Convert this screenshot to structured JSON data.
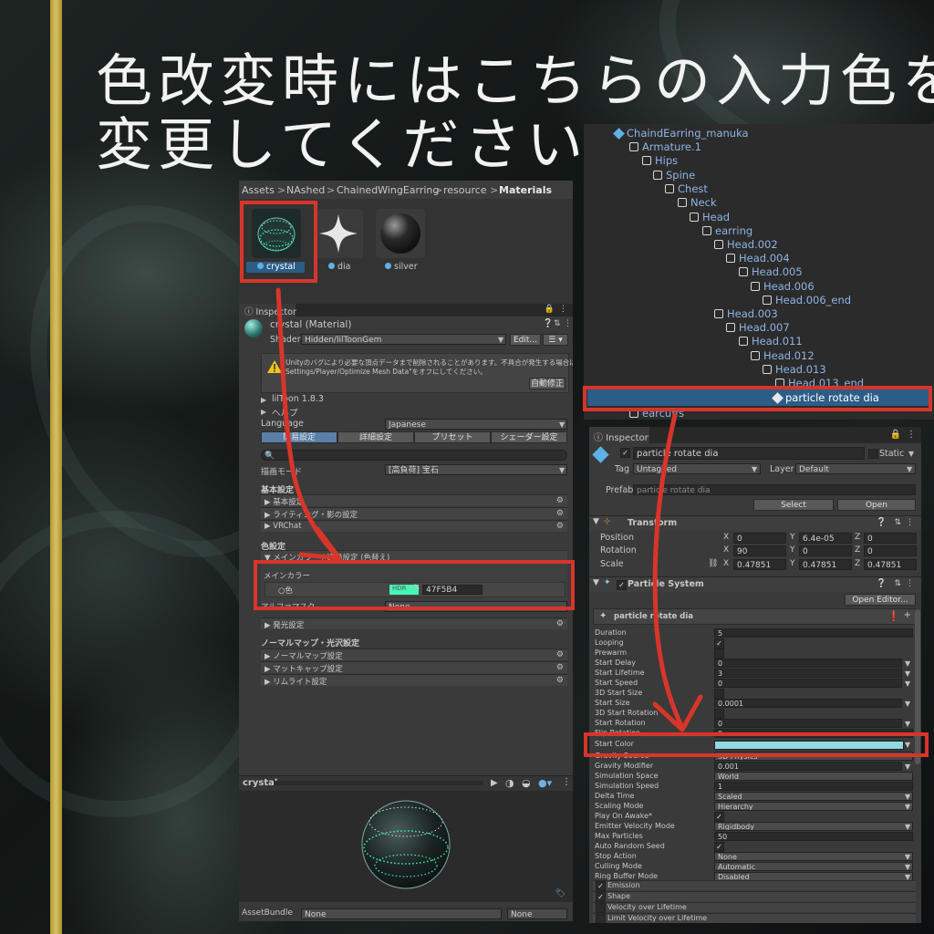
{
  "headline": {
    "line1": "色改変時にはこちらの入力色を",
    "line2": "変更してください。"
  },
  "project": {
    "breadcrumb": [
      "Assets",
      "NAshed",
      "ChainedWingEarring",
      "resource",
      "Materials"
    ],
    "assets": [
      {
        "name": "crystal"
      },
      {
        "name": "dia"
      },
      {
        "name": "silver"
      }
    ]
  },
  "inspector_left": {
    "tab": "Inspector",
    "material_title": "crystal (Material)",
    "shader_label": "Shader",
    "shader_value": "Hidden/lilToonGem",
    "edit_button": "Edit...",
    "warning_line1": "Unityのバグにより必要な頂点データまで削除されることがあります。不具合が発生する場合は\"Project",
    "warning_line2": "Settings/Player/Optimize Mesh Data\"をオフにしてください。",
    "autofix_button": "自動修正",
    "liltoon_version": "lilToon 1.8.3",
    "help": "ヘルプ",
    "language_label": "Language",
    "language_value": "Japanese",
    "tabs": [
      "簡易設定",
      "詳細設定",
      "プリセット",
      "シェーダー設定"
    ],
    "render_mode_label": "描画モード",
    "render_mode_value": "[高負荷] 宝石",
    "basic_heading": "基本設定",
    "basic_sections": [
      "基本設定",
      "ライティング・影の設定",
      "VRChat"
    ],
    "color_heading": "色設定",
    "maincolor_section": "メインカラー / 透過設定 (色替え)",
    "maincolor_label": "メインカラー",
    "color_label": "色",
    "hdr_tag": "HDR",
    "hex_value": "47F5B4",
    "alphamask_label": "アルファマスク",
    "alphamask_value": "None",
    "emission_section": "発光設定",
    "normal_heading": "ノーマルマップ・光沢設定",
    "normal_sections": [
      "ノーマルマップ設定",
      "マットキャップ設定",
      "リムライト設定"
    ],
    "preview_title": "crystal",
    "assetbundle_label": "AssetBundle",
    "assetbundle_value1": "None",
    "assetbundle_value2": "None"
  },
  "hierarchy": {
    "root": "ChaindEarring_manuka",
    "items": [
      {
        "label": "Armature.1"
      },
      {
        "label": "Hips"
      },
      {
        "label": "Spine"
      },
      {
        "label": "Chest"
      },
      {
        "label": "Neck"
      },
      {
        "label": "Head"
      },
      {
        "label": "earring"
      },
      {
        "label": "Head.002"
      },
      {
        "label": "Head.004"
      },
      {
        "label": "Head.005"
      },
      {
        "label": "Head.006"
      },
      {
        "label": "Head.006_end"
      },
      {
        "label": "Head.003"
      },
      {
        "label": "Head.007"
      },
      {
        "label": "Head.011"
      },
      {
        "label": "Head.012"
      },
      {
        "label": "Head.013"
      },
      {
        "label": "Head.013_end"
      }
    ],
    "selected": "particle rotate dia",
    "after": "earcuffs"
  },
  "inspector_right": {
    "tab": "Inspector",
    "object_name": "particle rotate dia",
    "static_label": "Static",
    "tag_label": "Tag",
    "tag_value": "Untagged",
    "layer_label": "Layer",
    "layer_value": "Default",
    "prefab_label": "Prefab",
    "prefab_value": "particle rotate dia",
    "select_button": "Select",
    "open_button": "Open",
    "transform_title": "Transform",
    "transform_rows": [
      {
        "label": "Position",
        "x": "0",
        "y": "6.4e-05",
        "z": "0"
      },
      {
        "label": "Rotation",
        "x": "90",
        "y": "0",
        "z": "0"
      },
      {
        "label": "Scale",
        "x": "0.47851",
        "y": "0.47851",
        "z": "0.47851"
      }
    ],
    "ps_title": "Particle System",
    "open_editor": "Open Editor...",
    "ps_subtitle": "particle rotate dia",
    "props": [
      {
        "label": "Duration",
        "value": "5"
      },
      {
        "label": "Looping",
        "value": "✓"
      },
      {
        "label": "Prewarm",
        "value": ""
      },
      {
        "label": "Start Delay",
        "value": "0"
      },
      {
        "label": "Start Lifetime",
        "value": "3"
      },
      {
        "label": "Start Speed",
        "value": "0"
      },
      {
        "label": "3D Start Size",
        "value": ""
      },
      {
        "label": "Start Size",
        "value": "0.0001"
      },
      {
        "label": "3D Start Rotation",
        "value": ""
      },
      {
        "label": "Start Rotation",
        "value": "0"
      },
      {
        "label": "Flip Rotation",
        "value": "0"
      },
      {
        "label": "Start Color",
        "value": ""
      },
      {
        "label": "Gravity Source",
        "value": "3D Physics"
      },
      {
        "label": "Gravity Modifier",
        "value": "0.001"
      },
      {
        "label": "Simulation Space",
        "value": "World"
      },
      {
        "label": "Simulation Speed",
        "value": "1"
      },
      {
        "label": "Delta Time",
        "value": "Scaled"
      },
      {
        "label": "Scaling Mode",
        "value": "Hierarchy"
      },
      {
        "label": "Play On Awake*",
        "value": "✓"
      },
      {
        "label": "Emitter Velocity Mode",
        "value": "Rigidbody"
      },
      {
        "label": "Max Particles",
        "value": "50"
      },
      {
        "label": "Auto Random Seed",
        "value": "✓"
      },
      {
        "label": "Stop Action",
        "value": "None"
      },
      {
        "label": "Culling Mode",
        "value": "Automatic"
      },
      {
        "label": "Ring Buffer Mode",
        "value": "Disabled"
      }
    ],
    "modules": [
      "Emission",
      "Shape",
      "Velocity over Lifetime",
      "Limit Velocity over Lifetime"
    ]
  },
  "colors": {
    "main_color": "#47F5B4",
    "start_color": "#8fd9e3",
    "highlight": "#d8352a",
    "accent_gold": "#c9b04a"
  }
}
